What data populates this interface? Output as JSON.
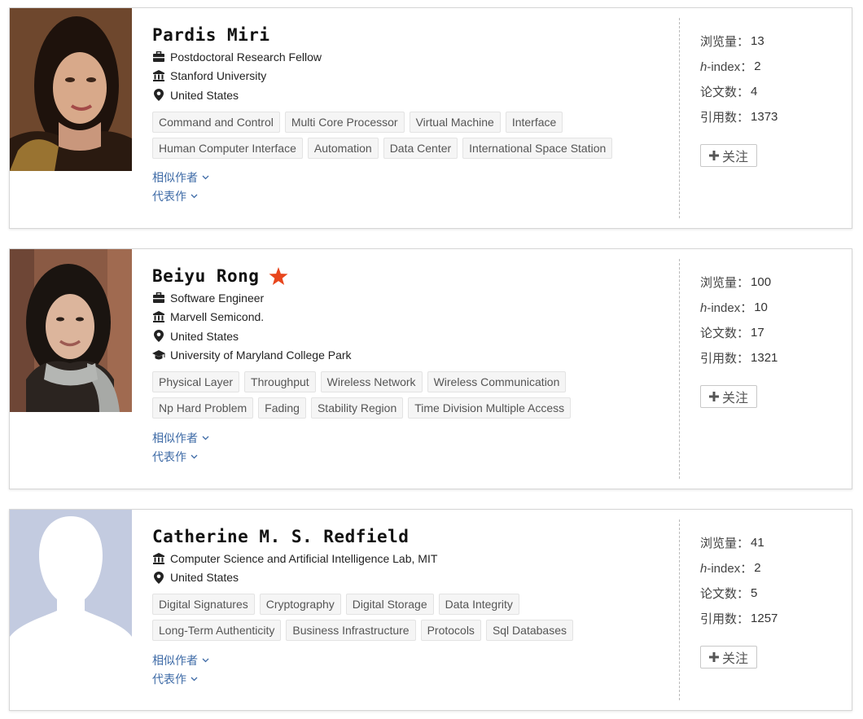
{
  "labels": {
    "views": "浏览量：",
    "hindex_italic": "h",
    "hindex_rest": "-index：",
    "papers": "论文数：",
    "citations": "引用数：",
    "follow": "关注",
    "similar_authors": "相似作者",
    "representative_works": "代表作"
  },
  "icons": {
    "position": "briefcase-icon",
    "org": "institution-icon",
    "location": "location-pin-icon",
    "education": "graduation-cap-icon",
    "follow": "plus-icon",
    "expand": "chevron-down-icon",
    "starred": "star-icon"
  },
  "colors": {
    "link": "#3d6aa6",
    "star": "#e8461d",
    "tag_bg": "#f5f5f5",
    "divider": "#b9b9b9"
  },
  "authors": [
    {
      "name": "Pardis Miri",
      "starred": false,
      "position": "Postdoctoral Research Fellow",
      "org": "Stanford University",
      "location": "United States",
      "tags": [
        "Command and Control",
        "Multi Core Processor",
        "Virtual Machine",
        "Interface",
        "Human Computer Interface",
        "Automation",
        "Data Center",
        "International Space Station"
      ],
      "views": "13",
      "hindex": "2",
      "papers": "4",
      "citations": "1373"
    },
    {
      "name": "Beiyu Rong",
      "starred": true,
      "position": "Software Engineer",
      "org": "Marvell Semicond.",
      "location": "United States",
      "education": "University of Maryland College Park",
      "tags": [
        "Physical Layer",
        "Throughput",
        "Wireless Network",
        "Wireless Communication",
        "Np Hard Problem",
        "Fading",
        "Stability Region",
        "Time Division Multiple Access"
      ],
      "views": "100",
      "hindex": "10",
      "papers": "17",
      "citations": "1321"
    },
    {
      "name": "Catherine M. S. Redfield",
      "starred": false,
      "org": "Computer Science and Artificial Intelligence Lab, MIT",
      "location": "United States",
      "tags": [
        "Digital Signatures",
        "Cryptography",
        "Digital Storage",
        "Data Integrity",
        "Long-Term Authenticity",
        "Business Infrastructure",
        "Protocols",
        "Sql Databases"
      ],
      "views": "41",
      "hindex": "2",
      "papers": "5",
      "citations": "1257"
    }
  ]
}
